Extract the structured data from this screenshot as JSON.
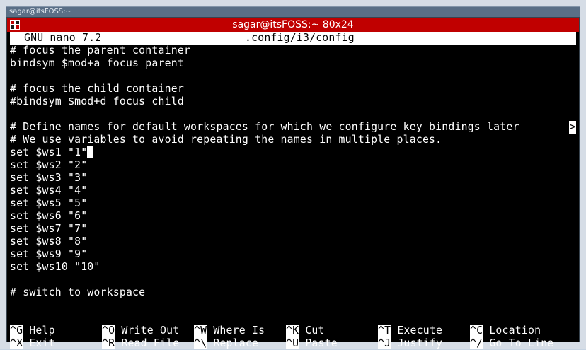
{
  "window": {
    "i3_title": "sagar@itsFOSS:~",
    "terminal_title": "sagar@itsFOSS:~ 80x24"
  },
  "nano": {
    "version_label": "GNU nano 7.2",
    "file_name": ".config/i3/config"
  },
  "lines": [
    "# focus the parent container",
    "bindsym $mod+a focus parent",
    "",
    "# focus the child container",
    "#bindsym $mod+d focus child",
    "",
    "# Define names for default workspaces for which we configure key bindings later",
    "# We use variables to avoid repeating the names in multiple places.",
    "set $ws1 \"1\"",
    "set $ws2 \"2\"",
    "set $ws3 \"3\"",
    "set $ws4 \"4\"",
    "set $ws5 \"5\"",
    "set $ws6 \"6\"",
    "set $ws7 \"7\"",
    "set $ws8 \"8\"",
    "set $ws9 \"9\"",
    "set $ws10 \"10\"",
    "",
    "# switch to workspace",
    ""
  ],
  "overflow_marker": ">",
  "shortcuts_row1": [
    {
      "key": "^G",
      "label": "Help"
    },
    {
      "key": "^O",
      "label": "Write Out"
    },
    {
      "key": "^W",
      "label": "Where Is"
    },
    {
      "key": "^K",
      "label": "Cut"
    },
    {
      "key": "^T",
      "label": "Execute"
    },
    {
      "key": "^C",
      "label": "Location"
    }
  ],
  "shortcuts_row2": [
    {
      "key": "^X",
      "label": "Exit"
    },
    {
      "key": "^R",
      "label": "Read File"
    },
    {
      "key": "^\\",
      "label": "Replace"
    },
    {
      "key": "^U",
      "label": "Paste"
    },
    {
      "key": "^J",
      "label": "Justify"
    },
    {
      "key": "^/",
      "label": "Go To Line"
    }
  ],
  "colors": {
    "title_bar": "#c00000",
    "header_bg": "#ffffff",
    "background": "#000000",
    "text": "#ffffff"
  }
}
